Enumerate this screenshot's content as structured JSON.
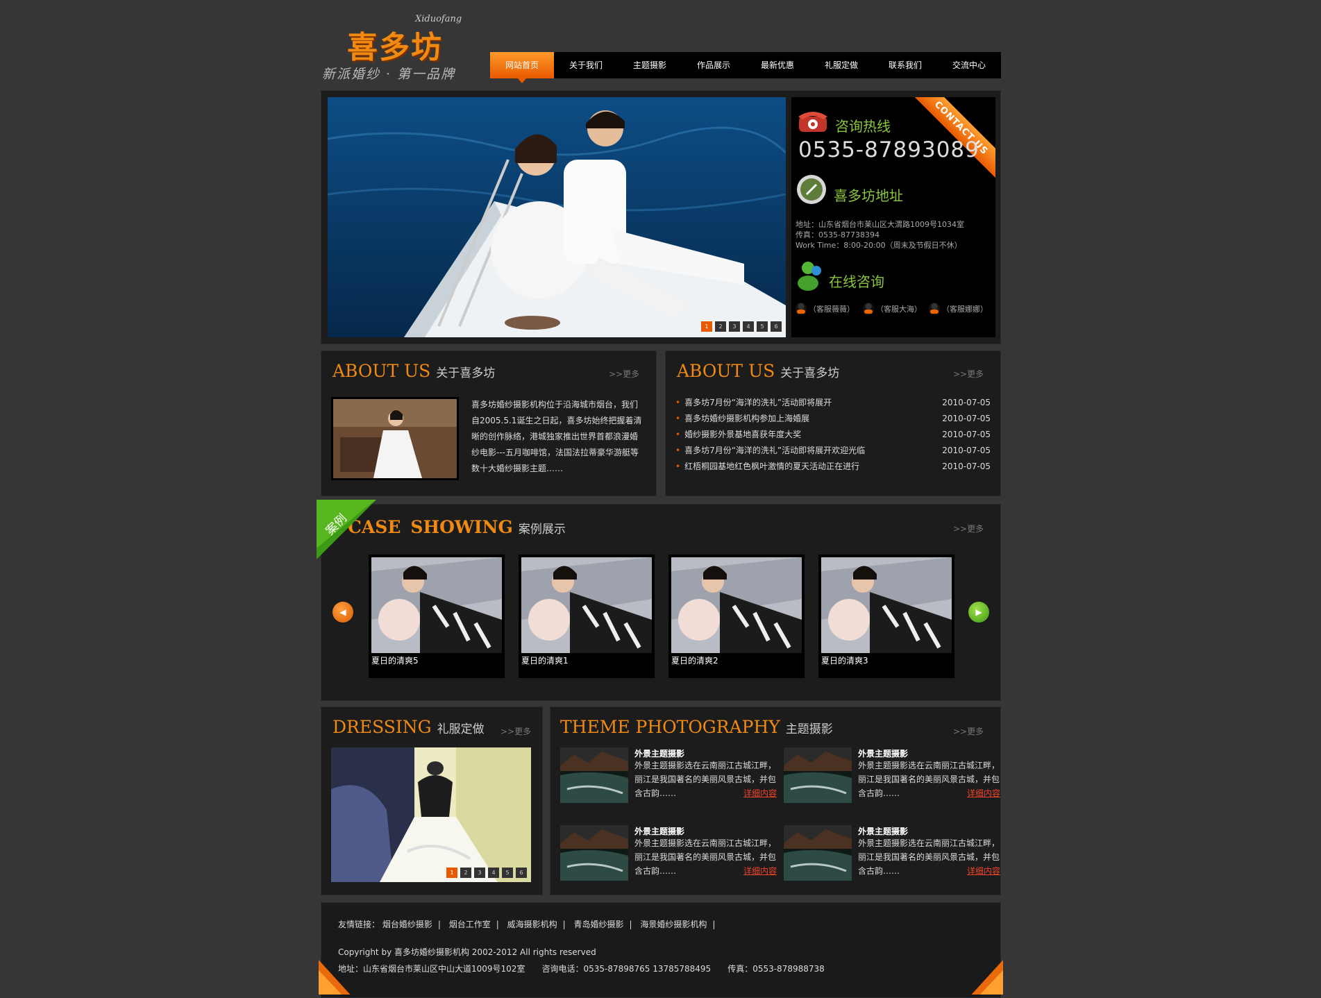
{
  "header": {
    "logo_script": "Xiduofang",
    "logo_title": "喜多坊",
    "logo_slogan": "新派婚纱 · 第一品牌"
  },
  "nav": [
    "网站首页",
    "关于我们",
    "主题摄影",
    "作品展示",
    "最新优惠",
    "礼服定做",
    "联系我们",
    "交流中心"
  ],
  "hero": {
    "pager": [
      "1",
      "2",
      "3",
      "4",
      "5",
      "6"
    ]
  },
  "contact": {
    "ribbon": "CONTACT US",
    "hotline_title": "咨询热线",
    "phone": "0535-87893089",
    "address_title": "喜多坊地址",
    "address": "地址：山东省烟台市莱山区大渭路1009号1034室",
    "fax": "传真：0535-87738394",
    "worktime": "Work Time：8:00-20:00（周末及节假日不休）",
    "online_title": "在线咨询",
    "qq": [
      "（客服薇薇）",
      "（客服大海）",
      "（客服娜娜）"
    ]
  },
  "about": {
    "title_en": "ABOUT US",
    "title_cn": "关于喜多坊",
    "more": ">>更多",
    "text": "喜多坊婚纱摄影机构位于沿海城市烟台，我们自2005.5.1诞生之日起，喜多坊始终把握着清晰的创作脉络，港城独家推出世界首都浪漫婚纱电影---五月咖啡馆，法国法拉蒂豪华游艇等数十大婚纱摄影主题……"
  },
  "news": {
    "title_en": "ABOUT US",
    "title_cn": "关于喜多坊",
    "more": ">>更多",
    "items": [
      {
        "title": "喜多坊7月份“海洋的洗礼”活动即将展开",
        "date": "2010-07-05"
      },
      {
        "title": "喜多坊婚纱摄影机构参加上海婚展",
        "date": "2010-07-05"
      },
      {
        "title": "婚纱摄影外景基地喜获年度大奖",
        "date": "2010-07-05"
      },
      {
        "title": "喜多坊7月份“海洋的洗礼”活动即将展开欢迎光临",
        "date": "2010-07-05"
      },
      {
        "title": "红梧桐园基地红色枫叶激情的夏天活动正在进行",
        "date": "2010-07-05"
      }
    ]
  },
  "cases": {
    "badge": "案例",
    "title_en_1": "CASE",
    "title_en_2": "SHOWING",
    "title_cn": "案例展示",
    "more": ">>更多",
    "items": [
      "夏日的清爽5",
      "夏日的清爽1",
      "夏日的清爽2",
      "夏日的清爽3"
    ]
  },
  "dressing": {
    "title_en": "DRESSING",
    "title_cn": "礼服定做",
    "more": ">>更多",
    "pager": [
      "1",
      "2",
      "3",
      "4",
      "5",
      "6"
    ]
  },
  "theme": {
    "title_en": "THEME PHOTOGRAPHY",
    "title_cn": "主题摄影",
    "more": ">>更多",
    "items": [
      {
        "heading": "外景主题摄影",
        "text": "外景主题摄影选在云南丽江古城江畔，丽江是我国著名的美丽风景古城，并包含古韵……",
        "link": "详细内容"
      },
      {
        "heading": "外景主题摄影",
        "text": "外景主题摄影选在云南丽江古城江畔，丽江是我国著名的美丽风景古城，并包含古韵……",
        "link": "详细内容"
      },
      {
        "heading": "外景主题摄影",
        "text": "外景主题摄影选在云南丽江古城江畔，丽江是我国著名的美丽风景古城，并包含古韵……",
        "link": "详细内容"
      },
      {
        "heading": "外景主题摄影",
        "text": "外景主题摄影选在云南丽江古城江畔，丽江是我国著名的美丽风景古城，并包含古韵……",
        "link": "详细内容"
      }
    ]
  },
  "footer": {
    "links_label": "友情链接：",
    "links": [
      "烟台婚纱摄影",
      "烟台工作室",
      "威海摄影机构",
      "青岛婚纱摄影",
      "海景婚纱摄影机构"
    ],
    "copyright": "Copyright by 喜多坊婚纱摄影机构 2002-2012 All rights reserved",
    "contact": "地址：山东省烟台市莱山区中山大道1009号102室　　咨询电话：0535-87898765  13785788495　　传真：0553-878988738"
  }
}
